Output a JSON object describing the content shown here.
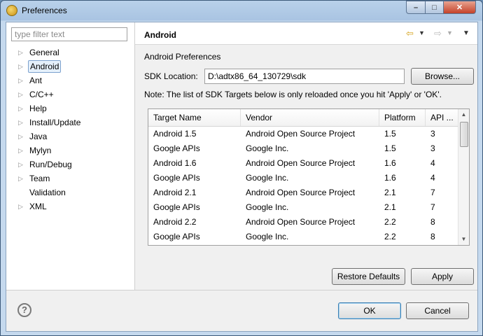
{
  "window": {
    "title": "Preferences"
  },
  "filter": {
    "placeholder": "type filter text"
  },
  "tree": [
    {
      "label": "General",
      "expandable": true,
      "selected": false
    },
    {
      "label": "Android",
      "expandable": true,
      "selected": true
    },
    {
      "label": "Ant",
      "expandable": true,
      "selected": false
    },
    {
      "label": "C/C++",
      "expandable": true,
      "selected": false
    },
    {
      "label": "Help",
      "expandable": true,
      "selected": false
    },
    {
      "label": "Install/Update",
      "expandable": true,
      "selected": false
    },
    {
      "label": "Java",
      "expandable": true,
      "selected": false
    },
    {
      "label": "Mylyn",
      "expandable": true,
      "selected": false
    },
    {
      "label": "Run/Debug",
      "expandable": true,
      "selected": false
    },
    {
      "label": "Team",
      "expandable": true,
      "selected": false
    },
    {
      "label": "Validation",
      "expandable": false,
      "selected": false
    },
    {
      "label": "XML",
      "expandable": true,
      "selected": false
    }
  ],
  "page": {
    "title": "Android",
    "section": "Android Preferences",
    "sdk_label": "SDK Location:",
    "sdk_value": "D:\\adtx86_64_130729\\sdk",
    "browse": "Browse...",
    "note": "Note: The list of SDK Targets below is only reloaded once you hit 'Apply' or 'OK'."
  },
  "table": {
    "columns": [
      "Target Name",
      "Vendor",
      "Platform",
      "API ..."
    ],
    "rows": [
      [
        "Android 1.5",
        "Android Open Source Project",
        "1.5",
        "3"
      ],
      [
        "Google APIs",
        "Google Inc.",
        "1.5",
        "3"
      ],
      [
        "Android 1.6",
        "Android Open Source Project",
        "1.6",
        "4"
      ],
      [
        "Google APIs",
        "Google Inc.",
        "1.6",
        "4"
      ],
      [
        "Android 2.1",
        "Android Open Source Project",
        "2.1",
        "7"
      ],
      [
        "Google APIs",
        "Google Inc.",
        "2.1",
        "7"
      ],
      [
        "Android 2.2",
        "Android Open Source Project",
        "2.2",
        "8"
      ],
      [
        "Google APIs",
        "Google Inc.",
        "2.2",
        "8"
      ]
    ]
  },
  "buttons": {
    "restore": "Restore Defaults",
    "apply": "Apply",
    "ok": "OK",
    "cancel": "Cancel"
  },
  "icons": {
    "back": "arrow-left-icon",
    "forward": "arrow-right-icon",
    "menu": "view-menu-icon",
    "help": "help-icon"
  }
}
